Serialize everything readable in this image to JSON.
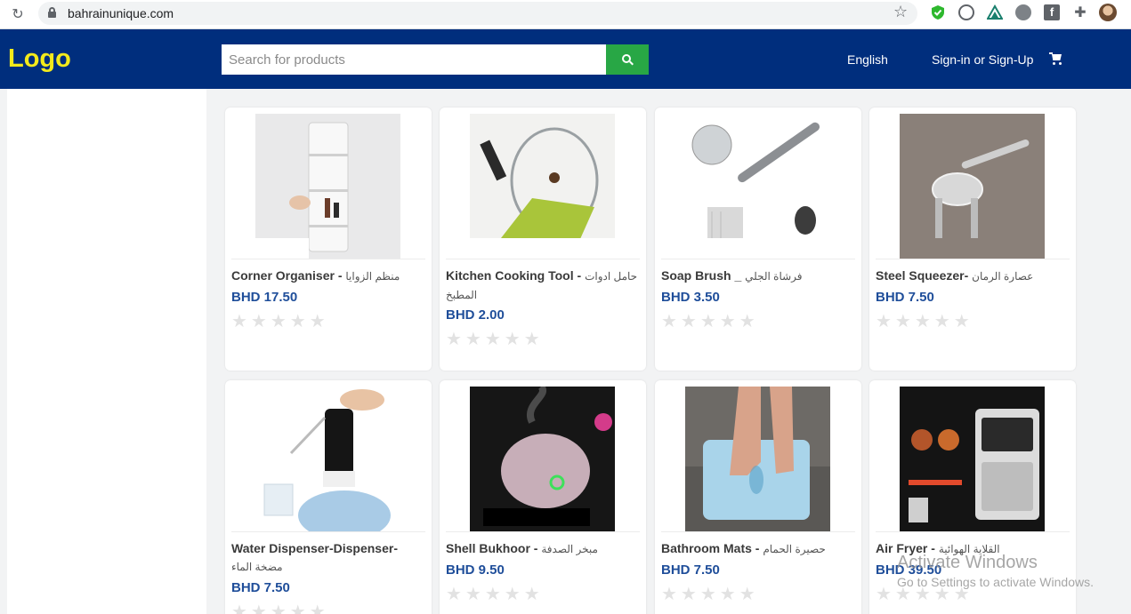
{
  "browser": {
    "url": "bahrainunique.com"
  },
  "header": {
    "logo": "Logo",
    "search_placeholder": "Search for products",
    "language": "English",
    "signin": "Sign-in or Sign-Up"
  },
  "products": [
    {
      "name_en": "Corner Organiser - ",
      "name_ar": "منظم الزوايا",
      "price": "BHD 17.50",
      "rating": 0
    },
    {
      "name_en": "Kitchen Cooking Tool - ",
      "name_ar": "حامل ادوات المطبخ",
      "price": "BHD 2.00",
      "rating": 0
    },
    {
      "name_en": "Soap Brush _ ",
      "name_ar": "فرشاة الجلي",
      "price": "BHD 3.50",
      "rating": 0
    },
    {
      "name_en": "Steel Squeezer- ",
      "name_ar": "عصارة الرمان",
      "price": "BHD 7.50",
      "rating": 0
    },
    {
      "name_en": "Water Dispenser-Dispenser- ",
      "name_ar": "مضخة الماء",
      "price": "BHD 7.50",
      "rating": 0
    },
    {
      "name_en": "Shell Bukhoor - ",
      "name_ar": "مبخر الصدفة",
      "price": "BHD 9.50",
      "rating": 0
    },
    {
      "name_en": "Bathroom Mats - ",
      "name_ar": "حصيرة الحمام",
      "price": "BHD 7.50",
      "rating": 0
    },
    {
      "name_en": "Air Fryer - ",
      "name_ar": "القلاية الهوائية",
      "price": "BHD 39.50",
      "rating": 0
    }
  ],
  "stars": "★★★★★",
  "watermark": {
    "line1": "Activate Windows",
    "line2": "Go to Settings to activate Windows."
  }
}
